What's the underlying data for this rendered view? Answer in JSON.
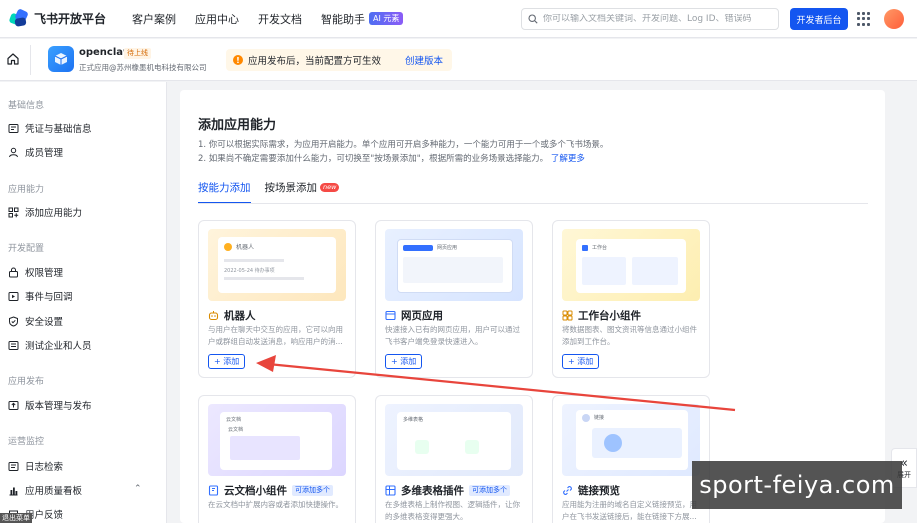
{
  "topnav": {
    "brand": "飞书开放平台",
    "links": [
      "客户案例",
      "应用中心",
      "开发文档",
      "智能助手"
    ],
    "ai_badge": "AI 元素",
    "search_placeholder": "你可以输入文档关键词、开发问题、Log ID、错误码",
    "dev_button": "开发者后台"
  },
  "app": {
    "name": "openclaw",
    "status": "待上线",
    "subtitle": "正式应用@苏州橡墨机电科技有限公司",
    "notice": "应用发布后，当前配置方可生效",
    "notice_link": "创建版本"
  },
  "sidebar": {
    "groups": [
      "基础信息",
      "应用能力",
      "开发配置",
      "应用发布",
      "运营监控"
    ],
    "items": [
      {
        "label": "凭证与基础信息"
      },
      {
        "label": "成员管理"
      },
      {
        "label": "添加应用能力"
      },
      {
        "label": "权限管理"
      },
      {
        "label": "事件与回调"
      },
      {
        "label": "安全设置"
      },
      {
        "label": "测试企业和人员"
      },
      {
        "label": "版本管理与发布"
      },
      {
        "label": "日志检索"
      },
      {
        "label": "应用质量看板"
      },
      {
        "label": "用户反馈"
      }
    ]
  },
  "main": {
    "title": "添加应用能力",
    "desc1": "1. 你可以根据实际需求，为应用开启能力。单个应用可开启多种能力，一个能力可用于一个或多个飞书场景。",
    "desc2": "2. 如果尚不确定需要添加什么能力，可切换至\"按场景添加\"，根据所需的业务场景选择能力。",
    "learn_more": "了解更多",
    "tabs": [
      "按能力添加",
      "按场景添加"
    ],
    "new_badge": "new"
  },
  "cards": [
    {
      "name": "机器人",
      "desc": "与用户在聊天中交互的应用，它可以向用户或群组自动发送消息，响应用户的消...",
      "add": "+ 添加",
      "tag": "",
      "preview_text_1": "机器人",
      "preview_text_2": "2022-05-24 待办事项"
    },
    {
      "name": "网页应用",
      "desc": "快速接入已有的网页应用，用户可以通过飞书客户端免登录快速进入。",
      "add": "+ 添加",
      "tag": "",
      "preview_text_1": "网页应用"
    },
    {
      "name": "工作台小组件",
      "desc": "将数据图表、图文资讯等信息通过小组件添加到工作台。",
      "add": "+ 添加",
      "tag": "",
      "preview_text_1": "工作台"
    },
    {
      "name": "云文档小组件",
      "desc": "在云文档中扩展内容或者添加快捷操作。",
      "add": "",
      "tag": "可添加多个",
      "preview_text_1": "云文档",
      "preview_text_2": "云文档"
    },
    {
      "name": "多维表格插件",
      "desc": "在多维表格上制作视图、逻辑插件，让你的多维表格变得更强大。",
      "add": "",
      "tag": "可添加多个",
      "preview_text_1": "多维表格"
    },
    {
      "name": "链接预览",
      "desc": "应用能为注册的域名自定义链接预览，用户在飞书发送链接后，能在链接下方展...",
      "add": "",
      "tag": "",
      "preview_text_1": "链接"
    }
  ],
  "float": {
    "collapse_label": "展开"
  },
  "watermark": "sport-feiya.com",
  "corner_tag": "退出菜单"
}
